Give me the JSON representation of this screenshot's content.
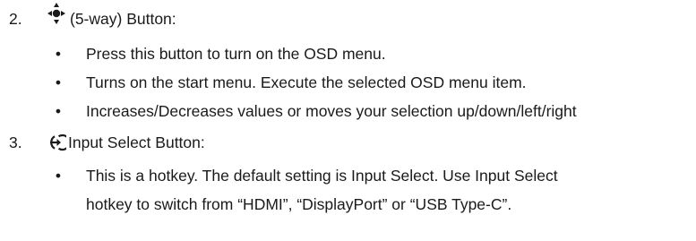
{
  "items": [
    {
      "number": "2.",
      "icon": "five-way-navigation-icon",
      "title": "(5-way) Button:",
      "bullets": [
        {
          "bullet": "•",
          "lines": [
            "Press this button to turn on the OSD menu."
          ]
        },
        {
          "bullet": "•",
          "lines": [
            "Turns on the start menu. Execute the selected OSD menu item."
          ]
        },
        {
          "bullet": "•",
          "lines": [
            "Increases/Decreases values or moves your selection up/down/left/right"
          ]
        }
      ]
    },
    {
      "number": "3.",
      "icon": "input-select-icon",
      "title": "Input Select Button:",
      "bullets": [
        {
          "bullet": "•",
          "lines": [
            "This is a hotkey. The default setting is Input Select. Use Input Select",
            "hotkey to switch from “HDMI”, “DisplayPort” or “USB Type-C”."
          ]
        }
      ]
    }
  ]
}
